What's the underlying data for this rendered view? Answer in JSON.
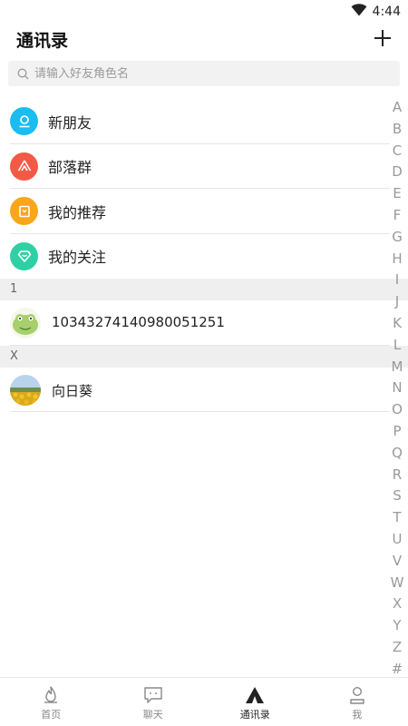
{
  "status_bar": {
    "time": "4:44",
    "wifi_icon": "wifi-icon"
  },
  "header": {
    "title": "通讯录",
    "add_icon": "plus-icon"
  },
  "search": {
    "placeholder": "请输入好友角色名",
    "value": ""
  },
  "function_items": [
    {
      "label": "新朋友",
      "icon": "new-friend-icon",
      "color": "#1bbcf0"
    },
    {
      "label": "部落群",
      "icon": "tribe-icon",
      "color": "#f25a45"
    },
    {
      "label": "我的推荐",
      "icon": "recommend-icon",
      "color": "#f9a61a"
    },
    {
      "label": "我的关注",
      "icon": "follow-icon",
      "color": "#2fd1a4"
    }
  ],
  "sections": [
    {
      "letter": "1",
      "contacts": [
        {
          "name": "10343274140980051251",
          "avatar": "frog-avatar"
        }
      ]
    },
    {
      "letter": "X",
      "contacts": [
        {
          "name": "向日葵",
          "avatar": "sunflower-avatar"
        }
      ]
    }
  ],
  "index_letters": [
    "A",
    "B",
    "C",
    "D",
    "E",
    "F",
    "G",
    "H",
    "I",
    "J",
    "K",
    "L",
    "M",
    "N",
    "O",
    "P",
    "Q",
    "R",
    "S",
    "T",
    "U",
    "V",
    "W",
    "X",
    "Y",
    "Z",
    "#"
  ],
  "tabs": [
    {
      "label": "首页",
      "icon": "flame-icon",
      "active": false
    },
    {
      "label": "聊天",
      "icon": "chat-icon",
      "active": false
    },
    {
      "label": "通讯录",
      "icon": "tent-icon",
      "active": true
    },
    {
      "label": "我",
      "icon": "person-icon",
      "active": false
    }
  ]
}
